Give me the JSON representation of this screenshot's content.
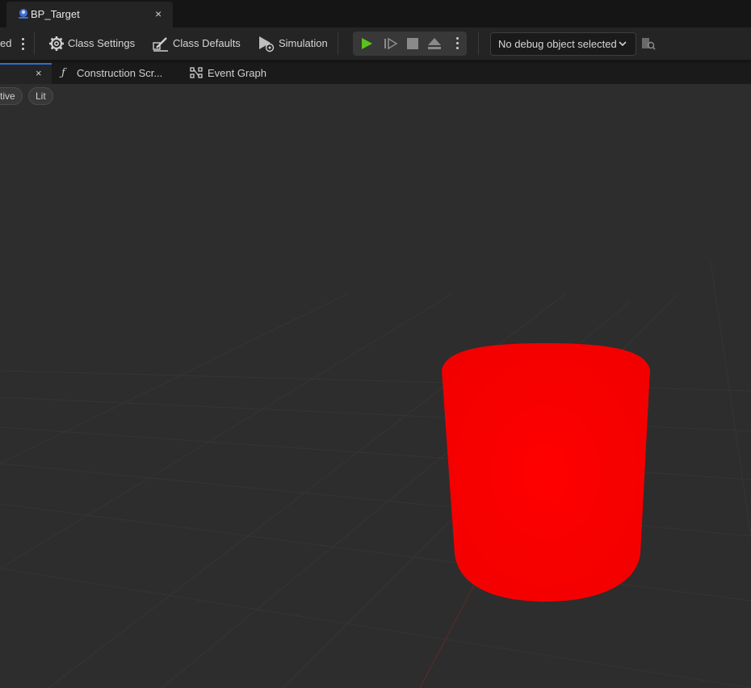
{
  "window": {
    "tab_title": "BP_Target",
    "tab_close": "×"
  },
  "toolbar": {
    "truncated_left_label": "ed",
    "class_settings": "Class Settings",
    "class_defaults": "Class Defaults",
    "simulation": "Simulation",
    "debug_object": "No debug object selected"
  },
  "editor_tabs": [
    {
      "label": "",
      "close": "×",
      "active": true
    },
    {
      "label": "Construction Scr...",
      "icon": "function-icon"
    },
    {
      "label": "Event Graph",
      "icon": "graph-icon"
    }
  ],
  "viewport": {
    "view_mode_pill": "tive",
    "lighting_pill": "Lit",
    "object": "red-cylinder",
    "object_color": "#ff0000"
  },
  "colors": {
    "accent_play": "#5cc21b",
    "accent_tab": "#2a6fd6",
    "viewport_bg": "#2d2d2d"
  }
}
